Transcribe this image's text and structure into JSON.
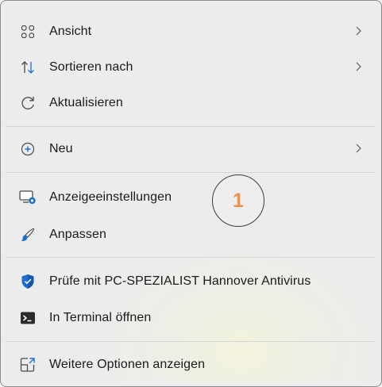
{
  "menu": {
    "items": [
      {
        "label": "Ansicht",
        "icon": "grid-view-icon",
        "has_submenu": true
      },
      {
        "label": "Sortieren nach",
        "icon": "sort-arrows-icon",
        "has_submenu": true
      },
      {
        "label": "Aktualisieren",
        "icon": "refresh-icon",
        "has_submenu": false
      },
      {
        "label": "Neu",
        "icon": "new-plus-icon",
        "has_submenu": true
      },
      {
        "label": "Anzeigeeinstellungen",
        "icon": "display-settings-icon",
        "has_submenu": false
      },
      {
        "label": "Anpassen",
        "icon": "paintbrush-icon",
        "has_submenu": false
      },
      {
        "label": "Prüfe mit PC-SPEZIALIST Hannover Antivirus",
        "icon": "shield-icon",
        "has_submenu": false
      },
      {
        "label": "In Terminal öffnen",
        "icon": "terminal-icon",
        "has_submenu": false
      },
      {
        "label": "Weitere Optionen anzeigen",
        "icon": "more-options-icon",
        "has_submenu": false
      }
    ]
  },
  "annotation": {
    "number": "1",
    "color": "#f0914a"
  },
  "colors": {
    "accent_blue": "#1f6fcf",
    "text": "#1a1a1a",
    "icon_gray": "#4a4a4a"
  }
}
